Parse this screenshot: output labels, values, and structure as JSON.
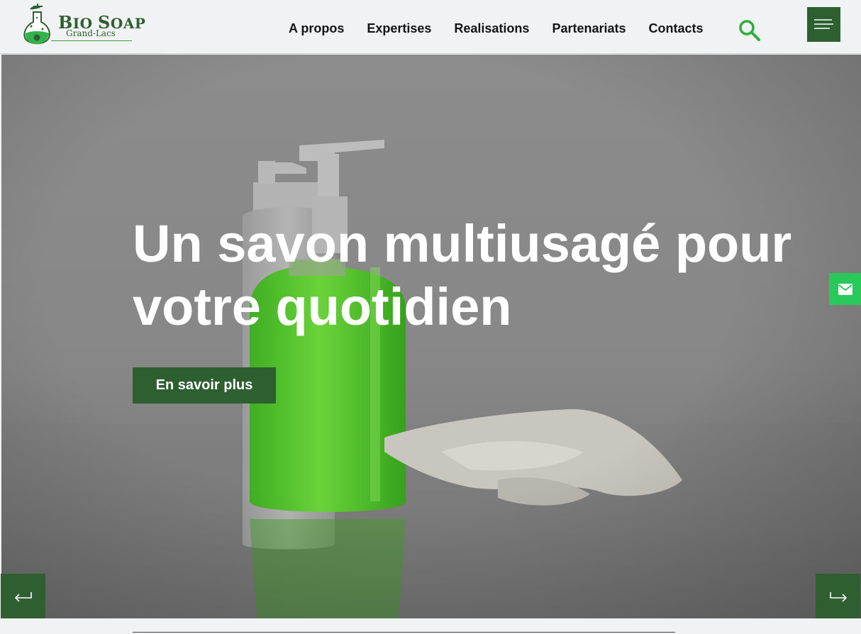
{
  "logo": {
    "brand_first_initial": "B",
    "brand_first_rest": "IO",
    "brand_second_initial": "S",
    "brand_second_rest": "OAP",
    "subtitle": "Grand-Lacs"
  },
  "nav": {
    "items": [
      {
        "label": "A propos"
      },
      {
        "label": "Expertises"
      },
      {
        "label": "Realisations"
      },
      {
        "label": "Partenariats"
      },
      {
        "label": "Contacts"
      }
    ]
  },
  "header": {
    "search_icon": "search-icon",
    "menu_icon": "hamburger-menu-icon"
  },
  "hero": {
    "title": "Un savon multiusagé pour votre quotidien",
    "cta_label": "En savoir plus"
  },
  "floating": {
    "mail_icon": "mail-icon"
  },
  "slider": {
    "prev_icon": "arrow-left-return-icon",
    "next_icon": "arrow-right-return-icon"
  },
  "colors": {
    "brand_dark_green": "#2d5f31",
    "accent_green": "#28c85a",
    "search_green": "#2fae3a"
  }
}
